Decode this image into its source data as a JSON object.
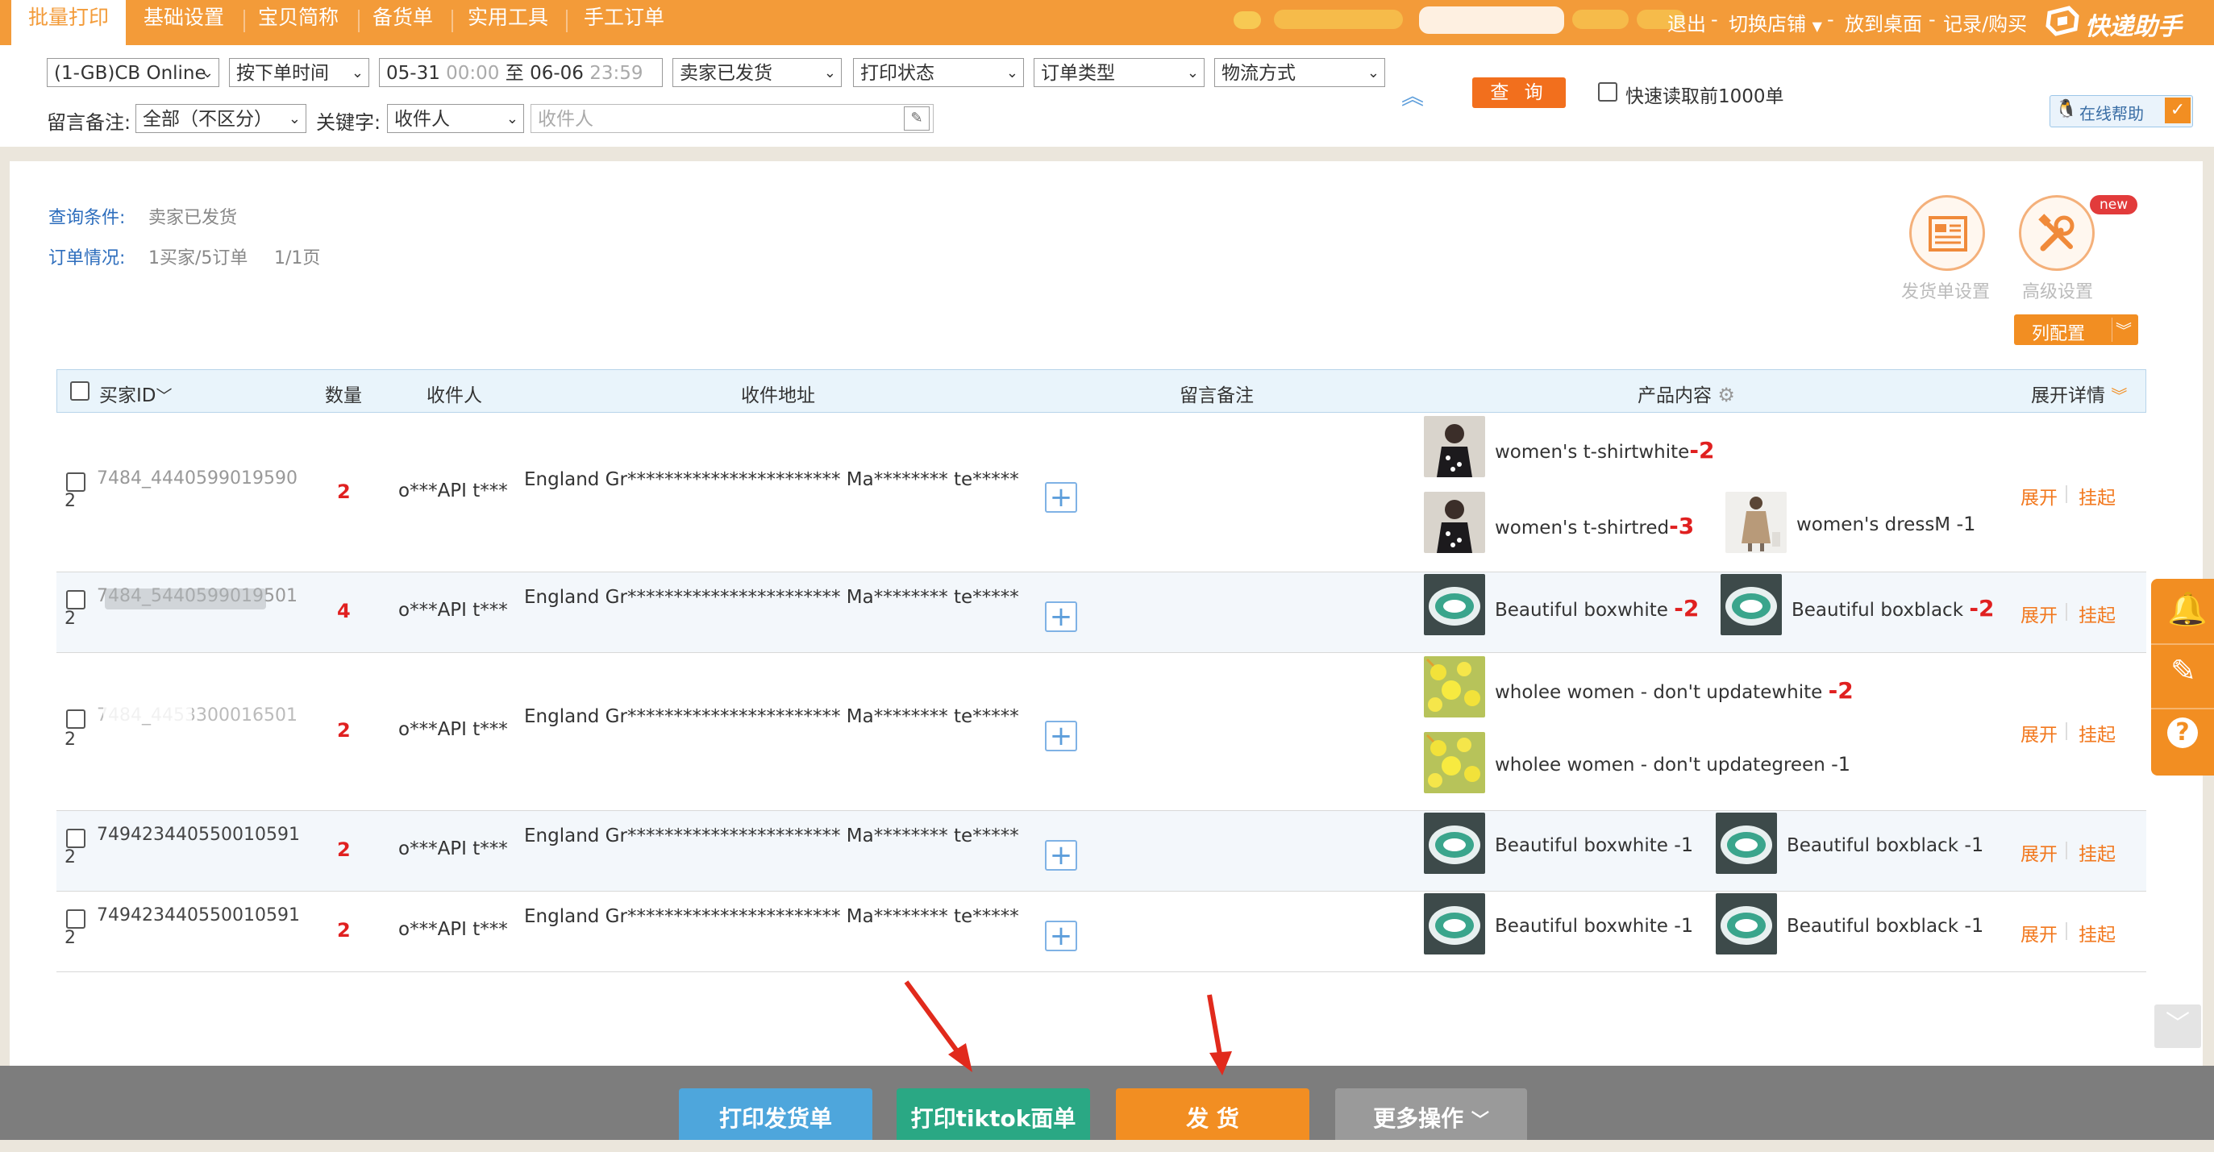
{
  "nav": {
    "tabs": [
      "批量打印",
      "基础设置",
      "宝贝简称",
      "备货单",
      "实用工具",
      "手工订单"
    ],
    "right": [
      "退出",
      "切换店铺",
      "放到桌面",
      "记录/购买"
    ],
    "logo": "快递助手"
  },
  "filter": {
    "shop": "(1-GB)CB Online",
    "sort": "按下单时间",
    "date_from": "05-31",
    "time_from": "00:00",
    "date_sep": "至",
    "date_to": "06-06",
    "time_to": "23:59",
    "order_status": "卖家已发货",
    "print_status": "打印状态",
    "order_type": "订单类型",
    "logistics": "物流方式",
    "query_btn": "查 询",
    "quick_read_label": "快速读取前1000单",
    "remark_label": "留言备注:",
    "remark_value": "全部（不区分）",
    "keyword_label": "关键字:",
    "keyword_type": "收件人",
    "keyword_placeholder": "收件人",
    "help": "在线帮助"
  },
  "summary": {
    "cond_key": "查询条件:",
    "cond_val": "卖家已发货",
    "order_key": "订单情况:",
    "order_val": "1买家/5订单",
    "page_val": "1/1页"
  },
  "tools": {
    "invoice_settings": "发货单设置",
    "advanced_settings": "高级设置",
    "new_badge": "new",
    "column_config": "列配置"
  },
  "table": {
    "headers": {
      "buyer": "买家ID",
      "qty": "数量",
      "receiver": "收件人",
      "address": "收件地址",
      "remark": "留言备注",
      "product": "产品内容",
      "expand": "展开详情"
    },
    "rows": [
      {
        "buyer": "7484_4440599019590",
        "buyer_line2": "2",
        "qty": "2",
        "receiver": "o***API t***",
        "address": "England Gr*********************** Ma******** te*****",
        "products": [
          {
            "name": "women's t-shirtwhite",
            "count": "-2",
            "thumb": "dress"
          },
          {
            "name": "women's t-shirtred",
            "count": "-3",
            "thumb": "dress"
          },
          {
            "name": "women's dressM",
            "count": "-1",
            "thumb": "person"
          }
        ],
        "expand": "展开",
        "hold": "挂起"
      },
      {
        "buyer": "7484_5440599019501",
        "buyer_line2": "2",
        "qty": "4",
        "receiver": "o***API t***",
        "address": "England Gr*********************** Ma******** te*****",
        "products": [
          {
            "name": "Beautiful boxwhite",
            "count": "-2",
            "thumb": "bowl"
          },
          {
            "name": "Beautiful boxblack",
            "count": "-2",
            "thumb": "bowl"
          }
        ],
        "expand": "展开",
        "hold": "挂起"
      },
      {
        "buyer": "7484_4453300016501",
        "buyer_line2": "2",
        "qty": "2",
        "receiver": "o***API t***",
        "address": "England Gr*********************** Ma******** te*****",
        "products": [
          {
            "name": "wholee women - don't updatewhite",
            "count": "-2",
            "thumb": "flower"
          },
          {
            "name": "wholee women - don't updategreen",
            "count": "-1",
            "thumb": "flower"
          }
        ],
        "expand": "展开",
        "hold": "挂起"
      },
      {
        "buyer": "749423440550010591",
        "buyer_line2": "2",
        "qty": "2",
        "receiver": "o***API t***",
        "address": "England Gr*********************** Ma******** te*****",
        "products": [
          {
            "name": "Beautiful boxwhite",
            "count": "-1",
            "thumb": "bowl"
          },
          {
            "name": "Beautiful boxblack",
            "count": "-1",
            "thumb": "bowl"
          }
        ],
        "expand": "展开",
        "hold": "挂起"
      },
      {
        "buyer": "749423440550010591",
        "buyer_line2": "2",
        "qty": "2",
        "receiver": "o***API t***",
        "address": "England Gr*********************** Ma******** te*****",
        "products": [
          {
            "name": "Beautiful boxwhite",
            "count": "-1",
            "thumb": "bowl"
          },
          {
            "name": "Beautiful boxblack",
            "count": "-1",
            "thumb": "bowl"
          }
        ],
        "expand": "展开",
        "hold": "挂起"
      }
    ]
  },
  "bottom": {
    "print_invoice": "打印发货单",
    "print_tiktok": "打印tiktok面单",
    "ship": "发 货",
    "more": "更多操作"
  },
  "colors": {
    "accent": "#f39b39",
    "red": "#e02020",
    "blue_btn": "#4ea6dc",
    "green_btn": "#2aa884",
    "orange_btn": "#f28e22",
    "gray_btn": "#9a9a9a"
  }
}
